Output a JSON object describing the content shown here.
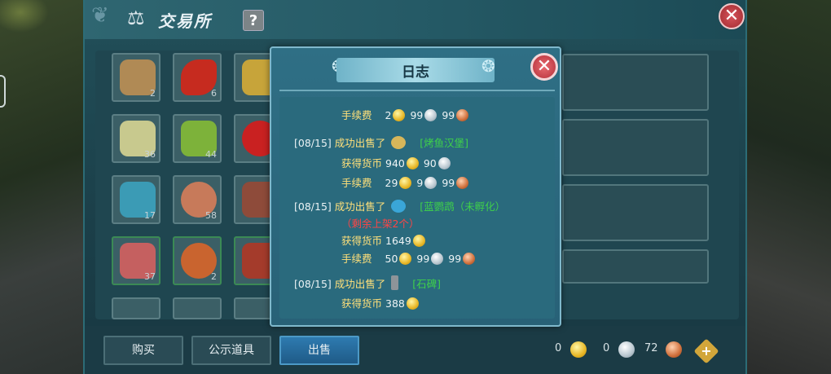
{
  "window": {
    "title": "交易所",
    "help": "?",
    "close": "✕"
  },
  "grid": {
    "items": [
      {
        "name": "dried-meat",
        "count": "2",
        "color": "#b08a55"
      },
      {
        "name": "chili-pepper",
        "count": "6",
        "color": "#c62b1f"
      },
      {
        "name": "corn-stalk",
        "count": "",
        "color": "#c7a43a"
      },
      {
        "name": "scallion",
        "count": "36",
        "color": "#c8c98e"
      },
      {
        "name": "green-beans",
        "count": "44",
        "color": "#7db23a"
      },
      {
        "name": "tomato",
        "count": "",
        "color": "#c92121"
      },
      {
        "name": "blue-triangle-gem",
        "count": "17",
        "color": "#3b9bb5"
      },
      {
        "name": "ham-leg",
        "count": "58",
        "color": "#c77a5a"
      },
      {
        "name": "meat-slab",
        "count": "",
        "color": "#8e4b3a"
      },
      {
        "name": "bacon",
        "count": "37",
        "color": "#c56060"
      },
      {
        "name": "chicken-leg",
        "count": "2",
        "color": "#c9642f"
      },
      {
        "name": "sliced-meat",
        "count": "",
        "color": "#a43b2b"
      }
    ]
  },
  "bottom": {
    "buy_label": "购买",
    "showcase_label": "公示道具",
    "sell_label": "出售",
    "gold": "0",
    "silver": "0",
    "copper": "72",
    "plus": "+"
  },
  "modal": {
    "title": "日志",
    "close": "✕",
    "entries": {
      "fee0_label": "手续费",
      "fee0_gold": "2",
      "fee0_silver": "99",
      "fee0_copper": "99",
      "e1_date": "[08/15]",
      "e1_action": "成功出售了",
      "e1_item": "[烤鱼汉堡]",
      "e1_earn_label": "获得货币",
      "e1_earn_gold": "940",
      "e1_earn_silver": "90",
      "e1_fee_label": "手续费",
      "e1_fee_gold": "29",
      "e1_fee_silver": "9",
      "e1_fee_copper": "99",
      "e2_date": "[08/15]",
      "e2_action": "成功出售了",
      "e2_item": "[蓝鹦鹉（未孵化）",
      "e2_note": "（剩余上架2个）",
      "e2_earn_label": "获得货币",
      "e2_earn_gold": "1649",
      "e2_fee_label": "手续费",
      "e2_fee_gold": "50",
      "e2_fee_silver": "99",
      "e2_fee_copper": "99",
      "e3_date": "[08/15]",
      "e3_action": "成功出售了",
      "e3_item": "[石碑]",
      "e3_earn_label": "获得货币",
      "e3_earn_gold": "388"
    }
  }
}
